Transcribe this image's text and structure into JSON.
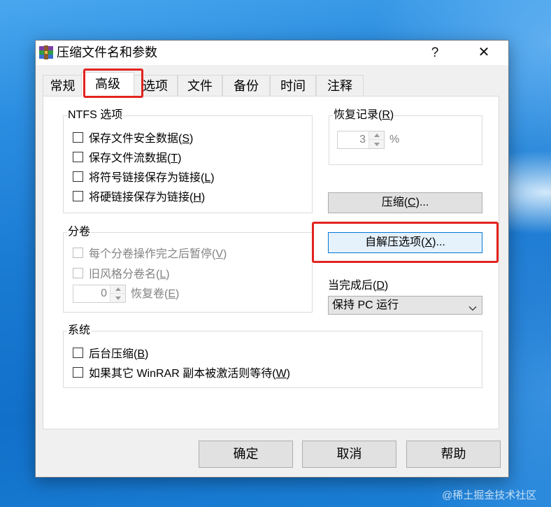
{
  "window": {
    "title": "压缩文件名和参数",
    "icon": "winrar-icon",
    "help_glyph": "?",
    "close_glyph": "✕"
  },
  "tabs": [
    {
      "label": "常规",
      "selected": false
    },
    {
      "label": "高级",
      "selected": true
    },
    {
      "label": "选项",
      "selected": false
    },
    {
      "label": "文件",
      "selected": false
    },
    {
      "label": "备份",
      "selected": false
    },
    {
      "label": "时间",
      "selected": false
    },
    {
      "label": "注释",
      "selected": false
    }
  ],
  "ntfs_group": {
    "title": "NTFS 选项",
    "options": [
      {
        "label": "保存文件安全数据(S)",
        "checked": false,
        "enabled": true
      },
      {
        "label": "保存文件流数据(T)",
        "checked": false,
        "enabled": true
      },
      {
        "label": "将符号链接保存为链接(L)",
        "checked": false,
        "enabled": true
      },
      {
        "label": "将硬链接保存为链接(H)",
        "checked": false,
        "enabled": true
      }
    ]
  },
  "recovery_group": {
    "title": "恢复记录(R)",
    "value": "3",
    "unit": "%",
    "enabled": false
  },
  "compress_button": {
    "label": "压缩(C)..."
  },
  "volumes_group": {
    "title": "分卷",
    "options": [
      {
        "label": "每个分卷操作完之后暂停(V)",
        "checked": false,
        "enabled": false
      },
      {
        "label": "旧风格分卷名(L)",
        "checked": false,
        "enabled": false
      }
    ],
    "recovery_volumes": {
      "value": "0",
      "label": "恢复卷(E)",
      "enabled": false
    }
  },
  "sfx_button": {
    "label": "自解压选项(X)...",
    "focused": true
  },
  "after_completion": {
    "label": "当完成后(D)",
    "selected": "保持 PC 运行"
  },
  "system_group": {
    "title": "系统",
    "options": [
      {
        "label": "后台压缩(B)",
        "checked": false,
        "enabled": true
      },
      {
        "label": "如果其它 WinRAR 副本被激活则等待(W)",
        "checked": false,
        "enabled": true
      }
    ]
  },
  "footer": {
    "ok": "确定",
    "cancel": "取消",
    "help": "帮助"
  },
  "watermark": "@稀土掘金技术社区",
  "colors": {
    "highlight": "#e3231f",
    "focus_border": "#0078d7"
  }
}
